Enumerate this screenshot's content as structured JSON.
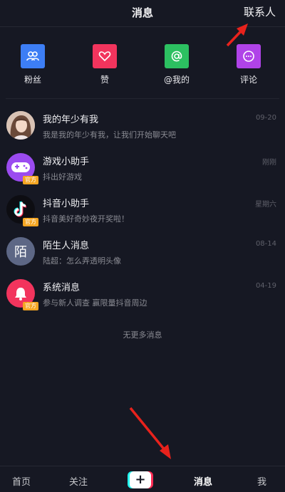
{
  "header": {
    "title": "消息",
    "contacts_label": "联系人"
  },
  "categories": [
    {
      "label": "粉丝",
      "icon": "fans-icon",
      "color": "#3d7ef5"
    },
    {
      "label": "赞",
      "icon": "heart-icon",
      "color": "#f2345d"
    },
    {
      "label": "@我的",
      "icon": "at-icon",
      "color": "#2cc061"
    },
    {
      "label": "评论",
      "icon": "comment-icon",
      "color": "#b043e8"
    }
  ],
  "messages": [
    {
      "title": "我的年少有我",
      "subtitle": "我是我的年少有我，让我们开始聊天吧",
      "time": "09-20",
      "badge": ""
    },
    {
      "title": "游戏小助手",
      "subtitle": "抖出好游戏",
      "time": "刚刚",
      "badge": "官方"
    },
    {
      "title": "抖音小助手",
      "subtitle": "抖音美好奇妙夜开奖啦！",
      "time": "星期六",
      "badge": "官方"
    },
    {
      "title": "陌生人消息",
      "subtitle": "陆超：怎么弄透明头像",
      "time": "08-14",
      "badge": "",
      "avatar_char": "陌"
    },
    {
      "title": "系统消息",
      "subtitle": "参与新人调查 赢限量抖音周边",
      "time": "04-19",
      "badge": "官方"
    }
  ],
  "footer_note": "无更多消息",
  "tabbar": {
    "home": "首页",
    "follow": "关注",
    "plus": "+",
    "messages": "消息",
    "me": "我"
  },
  "colors": {
    "background": "#161823",
    "annotation_arrow": "#e8221c",
    "badge": "#f5a623"
  }
}
